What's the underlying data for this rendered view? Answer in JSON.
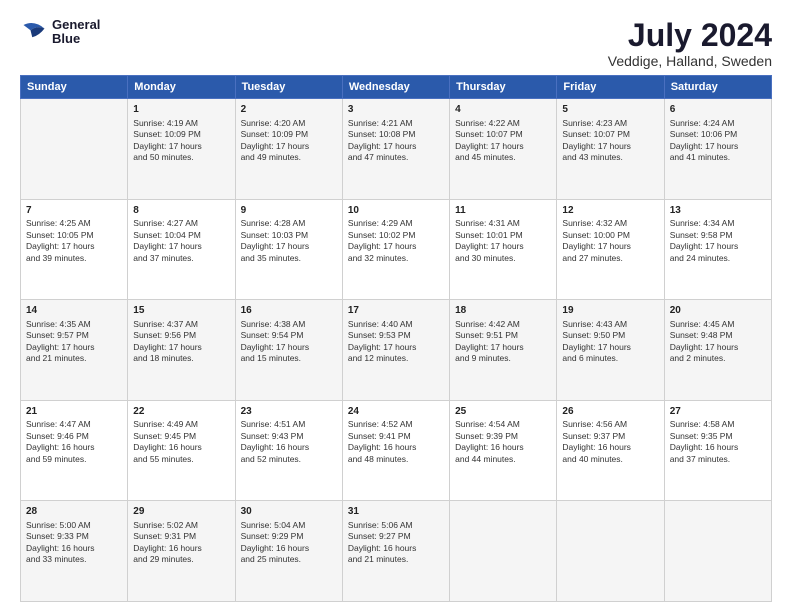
{
  "logo": {
    "line1": "General",
    "line2": "Blue"
  },
  "title": "July 2024",
  "subtitle": "Veddige, Halland, Sweden",
  "headers": [
    "Sunday",
    "Monday",
    "Tuesday",
    "Wednesday",
    "Thursday",
    "Friday",
    "Saturday"
  ],
  "weeks": [
    [
      {
        "num": "",
        "info": ""
      },
      {
        "num": "1",
        "info": "Sunrise: 4:19 AM\nSunset: 10:09 PM\nDaylight: 17 hours\nand 50 minutes."
      },
      {
        "num": "2",
        "info": "Sunrise: 4:20 AM\nSunset: 10:09 PM\nDaylight: 17 hours\nand 49 minutes."
      },
      {
        "num": "3",
        "info": "Sunrise: 4:21 AM\nSunset: 10:08 PM\nDaylight: 17 hours\nand 47 minutes."
      },
      {
        "num": "4",
        "info": "Sunrise: 4:22 AM\nSunset: 10:07 PM\nDaylight: 17 hours\nand 45 minutes."
      },
      {
        "num": "5",
        "info": "Sunrise: 4:23 AM\nSunset: 10:07 PM\nDaylight: 17 hours\nand 43 minutes."
      },
      {
        "num": "6",
        "info": "Sunrise: 4:24 AM\nSunset: 10:06 PM\nDaylight: 17 hours\nand 41 minutes."
      }
    ],
    [
      {
        "num": "7",
        "info": "Sunrise: 4:25 AM\nSunset: 10:05 PM\nDaylight: 17 hours\nand 39 minutes."
      },
      {
        "num": "8",
        "info": "Sunrise: 4:27 AM\nSunset: 10:04 PM\nDaylight: 17 hours\nand 37 minutes."
      },
      {
        "num": "9",
        "info": "Sunrise: 4:28 AM\nSunset: 10:03 PM\nDaylight: 17 hours\nand 35 minutes."
      },
      {
        "num": "10",
        "info": "Sunrise: 4:29 AM\nSunset: 10:02 PM\nDaylight: 17 hours\nand 32 minutes."
      },
      {
        "num": "11",
        "info": "Sunrise: 4:31 AM\nSunset: 10:01 PM\nDaylight: 17 hours\nand 30 minutes."
      },
      {
        "num": "12",
        "info": "Sunrise: 4:32 AM\nSunset: 10:00 PM\nDaylight: 17 hours\nand 27 minutes."
      },
      {
        "num": "13",
        "info": "Sunrise: 4:34 AM\nSunset: 9:58 PM\nDaylight: 17 hours\nand 24 minutes."
      }
    ],
    [
      {
        "num": "14",
        "info": "Sunrise: 4:35 AM\nSunset: 9:57 PM\nDaylight: 17 hours\nand 21 minutes."
      },
      {
        "num": "15",
        "info": "Sunrise: 4:37 AM\nSunset: 9:56 PM\nDaylight: 17 hours\nand 18 minutes."
      },
      {
        "num": "16",
        "info": "Sunrise: 4:38 AM\nSunset: 9:54 PM\nDaylight: 17 hours\nand 15 minutes."
      },
      {
        "num": "17",
        "info": "Sunrise: 4:40 AM\nSunset: 9:53 PM\nDaylight: 17 hours\nand 12 minutes."
      },
      {
        "num": "18",
        "info": "Sunrise: 4:42 AM\nSunset: 9:51 PM\nDaylight: 17 hours\nand 9 minutes."
      },
      {
        "num": "19",
        "info": "Sunrise: 4:43 AM\nSunset: 9:50 PM\nDaylight: 17 hours\nand 6 minutes."
      },
      {
        "num": "20",
        "info": "Sunrise: 4:45 AM\nSunset: 9:48 PM\nDaylight: 17 hours\nand 2 minutes."
      }
    ],
    [
      {
        "num": "21",
        "info": "Sunrise: 4:47 AM\nSunset: 9:46 PM\nDaylight: 16 hours\nand 59 minutes."
      },
      {
        "num": "22",
        "info": "Sunrise: 4:49 AM\nSunset: 9:45 PM\nDaylight: 16 hours\nand 55 minutes."
      },
      {
        "num": "23",
        "info": "Sunrise: 4:51 AM\nSunset: 9:43 PM\nDaylight: 16 hours\nand 52 minutes."
      },
      {
        "num": "24",
        "info": "Sunrise: 4:52 AM\nSunset: 9:41 PM\nDaylight: 16 hours\nand 48 minutes."
      },
      {
        "num": "25",
        "info": "Sunrise: 4:54 AM\nSunset: 9:39 PM\nDaylight: 16 hours\nand 44 minutes."
      },
      {
        "num": "26",
        "info": "Sunrise: 4:56 AM\nSunset: 9:37 PM\nDaylight: 16 hours\nand 40 minutes."
      },
      {
        "num": "27",
        "info": "Sunrise: 4:58 AM\nSunset: 9:35 PM\nDaylight: 16 hours\nand 37 minutes."
      }
    ],
    [
      {
        "num": "28",
        "info": "Sunrise: 5:00 AM\nSunset: 9:33 PM\nDaylight: 16 hours\nand 33 minutes."
      },
      {
        "num": "29",
        "info": "Sunrise: 5:02 AM\nSunset: 9:31 PM\nDaylight: 16 hours\nand 29 minutes."
      },
      {
        "num": "30",
        "info": "Sunrise: 5:04 AM\nSunset: 9:29 PM\nDaylight: 16 hours\nand 25 minutes."
      },
      {
        "num": "31",
        "info": "Sunrise: 5:06 AM\nSunset: 9:27 PM\nDaylight: 16 hours\nand 21 minutes."
      },
      {
        "num": "",
        "info": ""
      },
      {
        "num": "",
        "info": ""
      },
      {
        "num": "",
        "info": ""
      }
    ]
  ]
}
